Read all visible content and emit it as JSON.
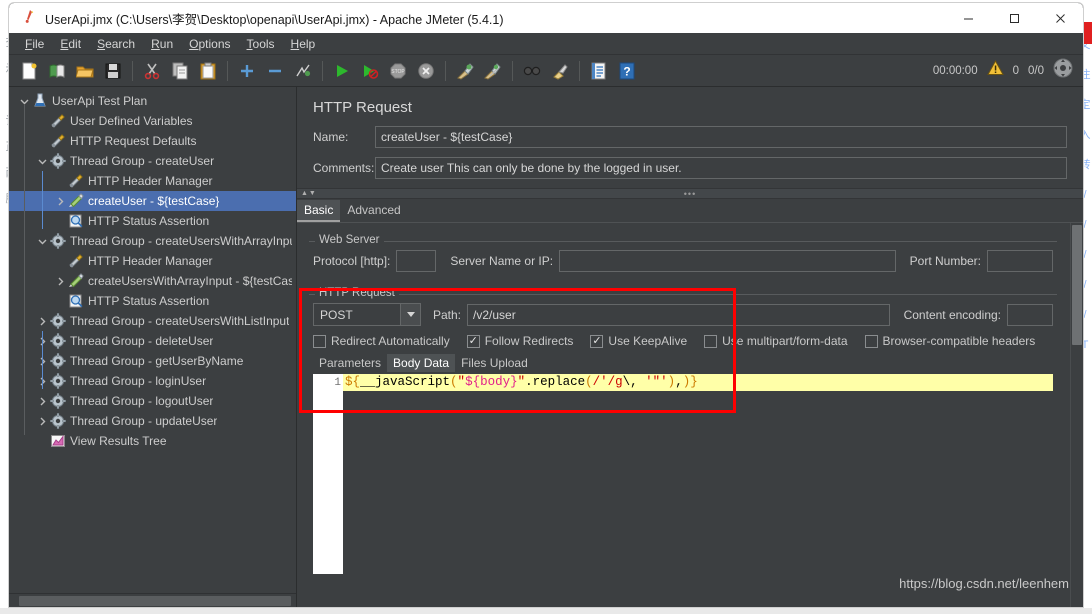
{
  "window": {
    "title": "UserApi.jmx (C:\\Users\\李贺\\Desktop\\openapi\\UserApi.jmx) - Apache JMeter (5.4.1)",
    "minimize_label": "—",
    "maximize_label": "□",
    "close_label": "✕"
  },
  "menubar": {
    "items": [
      {
        "mnemonic": "F",
        "rest": "ile"
      },
      {
        "mnemonic": "E",
        "rest": "dit"
      },
      {
        "mnemonic": "S",
        "rest": "earch"
      },
      {
        "mnemonic": "R",
        "rest": "un"
      },
      {
        "mnemonic": "O",
        "rest": "ptions"
      },
      {
        "mnemonic": "T",
        "rest": "ools"
      },
      {
        "mnemonic": "H",
        "rest": "elp"
      }
    ]
  },
  "toolbar": {
    "buttons": [
      {
        "name": "new-icon",
        "tip": "New"
      },
      {
        "name": "templates-icon",
        "tip": "Templates"
      },
      {
        "name": "open-icon",
        "tip": "Open"
      },
      {
        "name": "save-icon",
        "tip": "Save"
      },
      {
        "name": "cut-icon",
        "tip": "Cut"
      },
      {
        "name": "copy-icon",
        "tip": "Copy"
      },
      {
        "name": "paste-icon",
        "tip": "Paste"
      },
      {
        "name": "expand-all-icon",
        "tip": "Expand All"
      },
      {
        "name": "collapse-all-icon",
        "tip": "Collapse All"
      },
      {
        "name": "toggle-icon",
        "tip": "Toggle"
      },
      {
        "name": "start-icon",
        "tip": "Start"
      },
      {
        "name": "start-no-timers-icon",
        "tip": "Start no pauses"
      },
      {
        "name": "stop-icon",
        "tip": "Stop"
      },
      {
        "name": "shutdown-icon",
        "tip": "Shutdown"
      },
      {
        "name": "clear-icon",
        "tip": "Clear"
      },
      {
        "name": "clear-all-icon",
        "tip": "Clear All"
      },
      {
        "name": "search-icon",
        "tip": "Search"
      },
      {
        "name": "reset-search-icon",
        "tip": "Reset Search"
      },
      {
        "name": "function-helper-icon",
        "tip": "Function Helper Dialog"
      },
      {
        "name": "help-icon",
        "tip": "Help"
      }
    ],
    "status": {
      "elapsed": "00:00:00",
      "warning_count": "0",
      "threads": "0/0"
    }
  },
  "tree": {
    "nodes": [
      {
        "label": "UserApi Test Plan",
        "depth": 0,
        "twisty": "down",
        "icon": "test-plan-icon",
        "selected": false
      },
      {
        "label": "User Defined Variables",
        "depth": 1,
        "twisty": "none",
        "icon": "config-element-icon",
        "selected": false
      },
      {
        "label": "HTTP Request Defaults",
        "depth": 1,
        "twisty": "none",
        "icon": "config-element-icon",
        "selected": false
      },
      {
        "label": "Thread Group - createUser",
        "depth": 1,
        "twisty": "down",
        "icon": "thread-group-icon",
        "selected": false
      },
      {
        "label": "HTTP Header Manager",
        "depth": 2,
        "twisty": "none",
        "icon": "config-element-icon",
        "selected": false
      },
      {
        "label": "createUser - ${testCase}",
        "depth": 2,
        "twisty": "right",
        "icon": "http-sampler-icon",
        "selected": true
      },
      {
        "label": "HTTP Status Assertion",
        "depth": 2,
        "twisty": "none",
        "icon": "assertion-icon",
        "selected": false
      },
      {
        "label": "Thread Group - createUsersWithArrayInput",
        "depth": 1,
        "twisty": "down",
        "icon": "thread-group-icon",
        "selected": false
      },
      {
        "label": "HTTP Header Manager",
        "depth": 2,
        "twisty": "none",
        "icon": "config-element-icon",
        "selected": false
      },
      {
        "label": "createUsersWithArrayInput - ${testCase",
        "depth": 2,
        "twisty": "right",
        "icon": "http-sampler-icon",
        "selected": false
      },
      {
        "label": "HTTP Status Assertion",
        "depth": 2,
        "twisty": "none",
        "icon": "assertion-icon",
        "selected": false
      },
      {
        "label": "Thread Group - createUsersWithListInput",
        "depth": 1,
        "twisty": "right",
        "icon": "thread-group-icon",
        "selected": false
      },
      {
        "label": "Thread Group - deleteUser",
        "depth": 1,
        "twisty": "right",
        "icon": "thread-group-icon",
        "selected": false
      },
      {
        "label": "Thread Group - getUserByName",
        "depth": 1,
        "twisty": "right",
        "icon": "thread-group-icon",
        "selected": false
      },
      {
        "label": "Thread Group - loginUser",
        "depth": 1,
        "twisty": "right",
        "icon": "thread-group-icon",
        "selected": false
      },
      {
        "label": "Thread Group - logoutUser",
        "depth": 1,
        "twisty": "right",
        "icon": "thread-group-icon",
        "selected": false
      },
      {
        "label": "Thread Group - updateUser",
        "depth": 1,
        "twisty": "right",
        "icon": "thread-group-icon",
        "selected": false
      },
      {
        "label": "View Results Tree",
        "depth": 1,
        "twisty": "none",
        "icon": "view-results-tree-icon",
        "selected": false
      }
    ]
  },
  "main": {
    "panel_title": "HTTP Request",
    "name_label": "Name:",
    "name_value": "createUser - ${testCase}",
    "comments_label": "Comments:",
    "comments_value": "Create user This can only be done by the logged in user.",
    "tabs": [
      {
        "label": "Basic",
        "active": true
      },
      {
        "label": "Advanced",
        "active": false
      }
    ],
    "web_server": {
      "legend": "Web Server",
      "protocol_label": "Protocol [http]:",
      "protocol_value": "",
      "server_label": "Server Name or IP:",
      "server_value": "",
      "port_label": "Port Number:",
      "port_value": ""
    },
    "http_request": {
      "legend": "HTTP Request",
      "method_value": "POST",
      "path_label": "Path:",
      "path_value": "/v2/user",
      "content_encoding_label": "Content encoding:",
      "content_encoding_value": "",
      "checkboxes": [
        {
          "label": "Redirect Automatically",
          "checked": false
        },
        {
          "label": "Follow Redirects",
          "checked": true
        },
        {
          "label": "Use KeepAlive",
          "checked": true
        },
        {
          "label": "Use multipart/form-data",
          "checked": false
        },
        {
          "label": "Browser-compatible headers",
          "checked": false
        }
      ],
      "subtabs": [
        {
          "label": "Parameters",
          "active": false
        },
        {
          "label": "Body Data",
          "active": true
        },
        {
          "label": "Files Upload",
          "active": false
        }
      ],
      "body_data": {
        "line_number": "1",
        "raw": "${__javaScript(\"${body}\".replace(/'/g\\, '\"'),)}",
        "tokens": [
          {
            "t": "${",
            "c": "brace"
          },
          {
            "t": "__javaScript",
            "c": "fn"
          },
          {
            "t": "(",
            "c": "brace"
          },
          {
            "t": "\"",
            "c": "str"
          },
          {
            "t": "${body}",
            "c": "var"
          },
          {
            "t": "\"",
            "c": "str"
          },
          {
            "t": ".replace",
            "c": "plain"
          },
          {
            "t": "(",
            "c": "brace"
          },
          {
            "t": "/'/g",
            "c": "rx"
          },
          {
            "t": "\\, ",
            "c": "plain"
          },
          {
            "t": "'\"'",
            "c": "str"
          },
          {
            "t": ")",
            "c": "brace"
          },
          {
            "t": ",",
            "c": "plain"
          },
          {
            "t": ")",
            "c": "brace"
          },
          {
            "t": "}",
            "c": "brace"
          }
        ]
      }
    }
  },
  "annotation": {
    "color": "#ff0000",
    "label": "highlight-rectangle"
  },
  "watermark": {
    "text": "https://blog.csdn.net/leenhem"
  }
}
